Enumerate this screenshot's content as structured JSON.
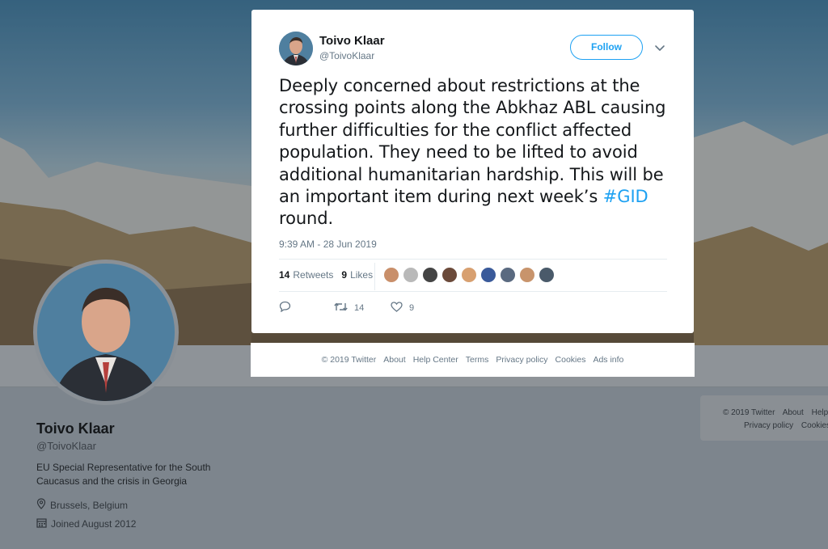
{
  "tweet": {
    "author_name": "Toivo Klaar",
    "author_handle": "@ToivoKlaar",
    "follow_label": "Follow",
    "text_before": "Deeply concerned about restrictions at the crossing points along the Abkhaz ABL causing further difficulties for the conflict affected population. They need to be lifted to avoid additional humanitarian hardship. This will be an important item during next week’s ",
    "hashtag": "#GID",
    "text_after": " round.",
    "timestamp": "9:39 AM - 28 Jun 2019",
    "retweets_count": "14",
    "retweets_label": "Retweets",
    "likes_count": "9",
    "likes_label": "Likes",
    "retweet_action_count": "14",
    "like_action_count": "9",
    "liker_colors": [
      "#c98f6a",
      "#b9b9b9",
      "#444444",
      "#6b4a3a",
      "#d8a070",
      "#3a5a9a",
      "#5a6a80",
      "#c8946c",
      "#4a5a6a"
    ]
  },
  "modal_footer": [
    "© 2019 Twitter",
    "About",
    "Help Center",
    "Terms",
    "Privacy policy",
    "Cookies",
    "Ads info"
  ],
  "profile": {
    "name": "Toivo Klaar",
    "handle": "@ToivoKlaar",
    "bio": "EU Special Representative for the South Caucasus and the crisis in Georgia",
    "location": "Brussels, Belgium",
    "joined": "Joined August 2012"
  },
  "side_footer": {
    "line1": [
      "© 2019 Twitter",
      "About",
      "Help"
    ],
    "line2": [
      "Privacy policy",
      "Cookies"
    ]
  }
}
